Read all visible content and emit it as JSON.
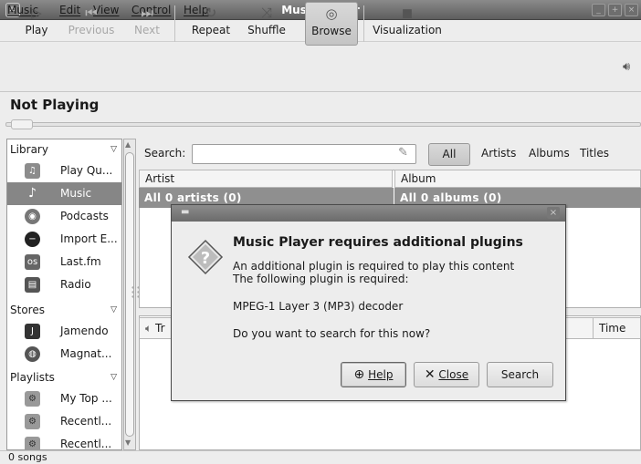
{
  "window": {
    "title": "Music Player"
  },
  "menu": [
    "Music",
    "Edit",
    "View",
    "Control",
    "Help"
  ],
  "toolbar": {
    "play": "Play",
    "previous": "Previous",
    "next": "Next",
    "repeat": "Repeat",
    "shuffle": "Shuffle",
    "browse": "Browse",
    "visualization": "Visualization"
  },
  "now_playing": "Not Playing",
  "sidebar": {
    "library_header": "Library",
    "library_items": [
      "Play Qu...",
      "Music",
      "Podcasts",
      "Import E...",
      "Last.fm",
      "Radio"
    ],
    "stores_header": "Stores",
    "stores_items": [
      "Jamendo",
      "Magnat..."
    ],
    "playlists_header": "Playlists",
    "playlists_items": [
      "My Top ...",
      "Recentl...",
      "Recentl..."
    ],
    "selected": "Music"
  },
  "search": {
    "label": "Search:",
    "value": "",
    "placeholder": ""
  },
  "filters": {
    "all": "All",
    "artists": "Artists",
    "albums": "Albums",
    "titles": "Titles"
  },
  "browser": {
    "artist_header": "Artist",
    "album_header": "Album",
    "all_artists": "All 0 artists (0)",
    "all_albums": "All 0 albums (0)"
  },
  "tracks": {
    "time_header": "Time",
    "title_header_partial": "Tr"
  },
  "status": "0 songs",
  "dialog": {
    "heading": "Music Player requires additional plugins",
    "line1": "An additional plugin is required to play this content",
    "line2": "The following plugin is required:",
    "plugin": "MPEG-1 Layer 3 (MP3) decoder",
    "question": "Do you want to search for this now?",
    "help_label": "Help",
    "close_label": "Close",
    "search_label": "Search"
  },
  "icons": {
    "play": "play-icon",
    "previous": "previous-icon",
    "next": "next-icon",
    "repeat": "repeat-icon",
    "shuffle": "shuffle-icon",
    "browse": "browse-icon",
    "visualization": "visualization-icon",
    "volume": "volume-icon"
  }
}
